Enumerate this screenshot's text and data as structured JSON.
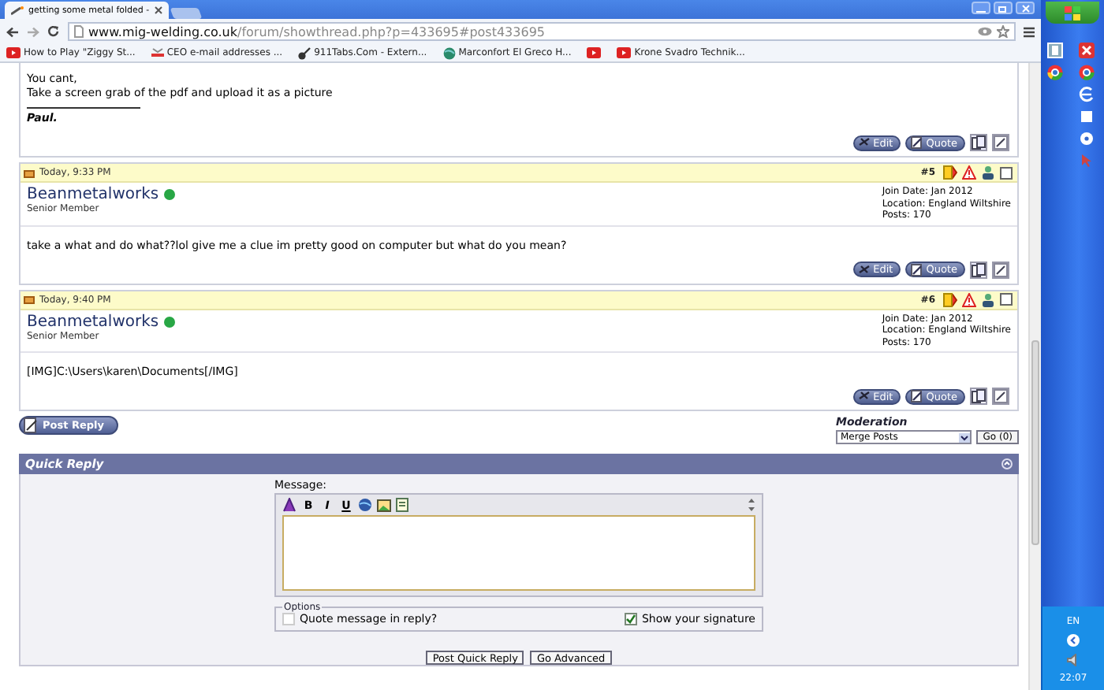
{
  "browser": {
    "tab_title": "getting some metal folded - ",
    "url_host": "www.mig-welding.co.uk",
    "url_path": "/forum/showthread.php?p=433695#post433695",
    "bookmarks": [
      {
        "kind": "video",
        "label": "How to Play \"Ziggy St..."
      },
      {
        "kind": "mail",
        "label": "CEO e-mail addresses ..."
      },
      {
        "kind": "guitar",
        "label": "911Tabs.Com - Extern..."
      },
      {
        "kind": "globe",
        "label": "Marconfort El Greco H..."
      },
      {
        "kind": "video"
      },
      {
        "kind": "video",
        "label": "Krone Svadro Technik..."
      }
    ]
  },
  "previous_post": {
    "lines": [
      "You cant,",
      "Take a screen grab of the pdf and upload it as a picture"
    ],
    "signature": "Paul.",
    "buttons": [
      "Edit",
      "Quote"
    ]
  },
  "posts": [
    {
      "date": "Today, 9:33 PM",
      "number": "#5",
      "checked": false,
      "username": "Beanmetalworks",
      "online": true,
      "rank": "Senior Member",
      "join_date": "Join Date: Jan 2012",
      "location": "Location: England Wiltshire",
      "post_count": "Posts: 170",
      "message": "take a what and do what??lol give me a clue im pretty good on computer but what do you mean?",
      "buttons": [
        "Edit",
        "Quote"
      ]
    },
    {
      "date": "Today, 9:40 PM",
      "number": "#6",
      "checked": false,
      "username": "Beanmetalworks",
      "online": true,
      "rank": "Senior Member",
      "join_date": "Join Date: Jan 2012",
      "location": "Location: England Wiltshire",
      "post_count": "Posts: 170",
      "message": "[IMG]C:\\Users\\karen\\Documents[/IMG]",
      "buttons": [
        "Edit",
        "Quote"
      ]
    }
  ],
  "post_reply": "Post Reply",
  "moderation": {
    "label": "Moderation",
    "selected_option": "Merge Posts",
    "go": "Go (0)"
  },
  "quick_reply": {
    "title": "Quick Reply",
    "message_label": "Message:",
    "format_buttons": [
      "B",
      "I",
      "U"
    ],
    "options_legend": "Options",
    "options": [
      {
        "label": "Quote message in reply?",
        "checked": false
      },
      {
        "label": "Show your signature",
        "checked": true
      }
    ],
    "buttons": [
      "Post Quick Reply",
      "Go Advanced"
    ]
  },
  "taskbar": {
    "language": "EN",
    "clock": "22:07"
  }
}
